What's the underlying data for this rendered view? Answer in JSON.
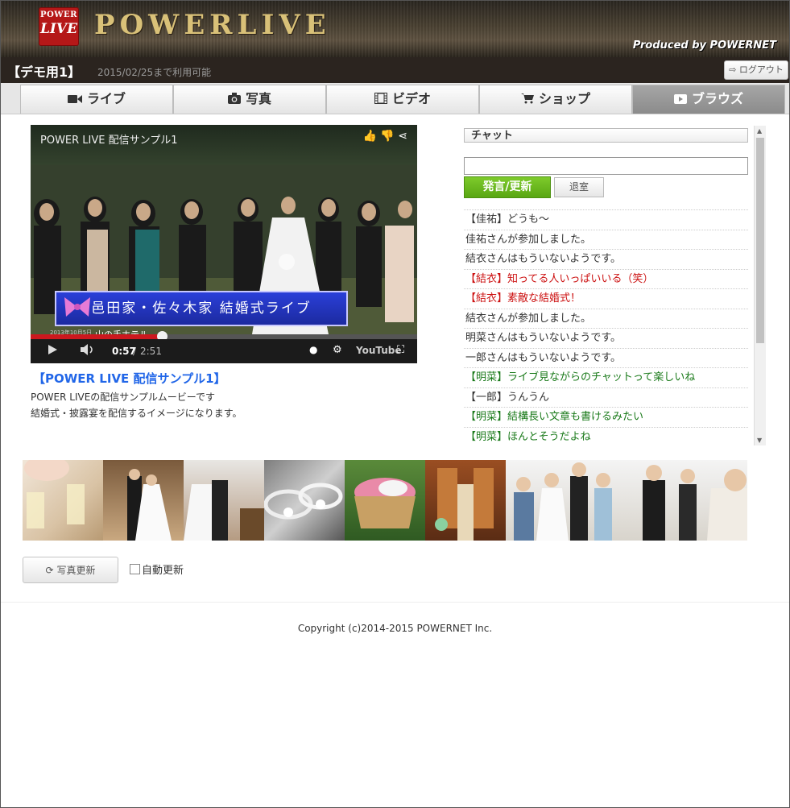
{
  "header": {
    "logo_top": "POWER",
    "logo_bottom": "LIVE",
    "brand": "POWERLIVE",
    "produced_by": "Produced by POWERNET"
  },
  "subbar": {
    "title": "【デモ用1】",
    "availability": "2015/02/25まで利用可能",
    "logout_label": "ログアウト"
  },
  "tabs": [
    {
      "label": "ライブ",
      "icon": "video-camera-icon",
      "active": false
    },
    {
      "label": "写真",
      "icon": "camera-icon",
      "active": false
    },
    {
      "label": "ビデオ",
      "icon": "film-icon",
      "active": false
    },
    {
      "label": "ショップ",
      "icon": "cart-icon",
      "active": false
    },
    {
      "label": "ブラウズ",
      "icon": "play-icon",
      "active": true
    }
  ],
  "video": {
    "title": "POWER LIVE 配信サンプル1",
    "banner_text": "邑田家・佐々木家 結婚式ライブ",
    "sub_text": "山の手ホテル",
    "date_text": "2013年10月5日",
    "current_time": "0:57",
    "duration": "2:51",
    "progress": 0.34,
    "link_title": "【POWER LIVE 配信サンプル1】",
    "description_line1": "POWER LIVEの配信サンプルムービーです",
    "description_line2": "結婚式・披露宴を配信するイメージになります。"
  },
  "chat": {
    "header": "チャット",
    "input_value": "",
    "send_label": "発言/更新",
    "leave_label": "退室",
    "messages": [
      {
        "text": "【佳祐】どうも〜",
        "color": "#333333"
      },
      {
        "text": "佳祐さんが参加しました。",
        "color": "#333333"
      },
      {
        "text": "結衣さんはもういないようです。",
        "color": "#333333"
      },
      {
        "text": "【結衣】知ってる人いっぱいいる（笑）",
        "color": "#cc1111"
      },
      {
        "text": "【結衣】素敵な結婚式！",
        "color": "#cc1111"
      },
      {
        "text": "結衣さんが参加しました。",
        "color": "#333333"
      },
      {
        "text": "明菜さんはもういないようです。",
        "color": "#333333"
      },
      {
        "text": "一郎さんはもういないようです。",
        "color": "#333333"
      },
      {
        "text": "【明菜】ライブ見ながらのチャットって楽しいね",
        "color": "#1a7a1a"
      },
      {
        "text": "【一郎】うんうん",
        "color": "#333333"
      },
      {
        "text": "【明菜】結構長い文章も書けるみたい",
        "color": "#1a7a1a"
      },
      {
        "text": "【明菜】ほんとそうだよね",
        "color": "#1a7a1a"
      }
    ]
  },
  "photos": {
    "refresh_label": "写真更新",
    "auto_label": "自動更新",
    "auto_checked": false
  },
  "footer": {
    "copyright": "Copyright (c)2014-2015 POWERNET Inc."
  }
}
